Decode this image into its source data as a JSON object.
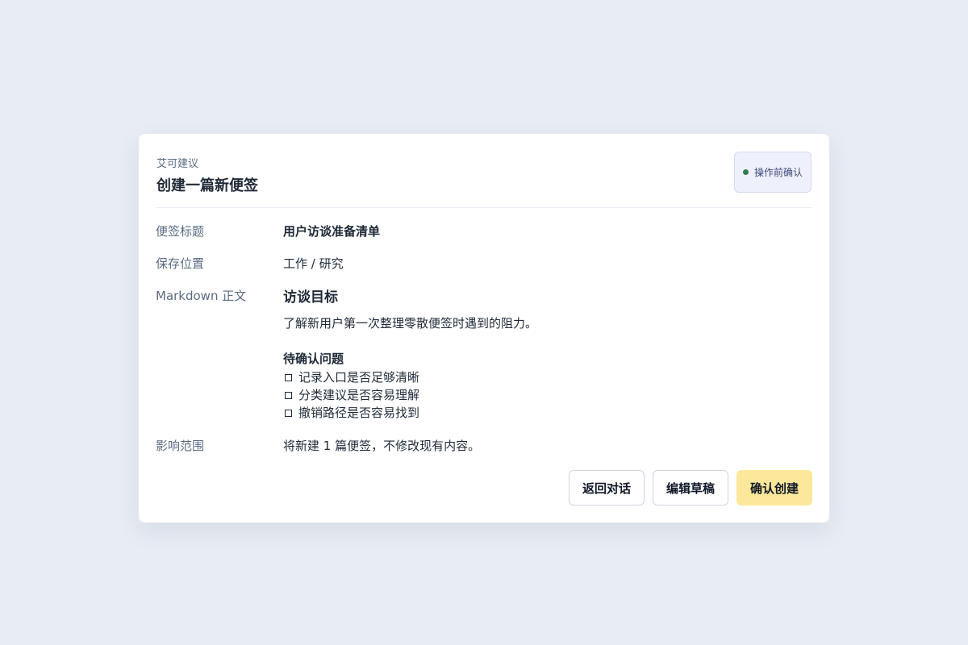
{
  "card": {
    "eyebrow": "艾可建议",
    "title": "创建一篇新便签",
    "badge": "操作前确认"
  },
  "fields": {
    "title_label": "便签标题",
    "title_value": "用户访谈准备清单",
    "location_label": "保存位置",
    "location_value": "工作 / 研究",
    "body_label": "Markdown 正文",
    "scope_label": "影响范围",
    "scope_value": "将新建 1 篇便签，不修改现有内容。"
  },
  "markdown": {
    "heading": "访谈目标",
    "paragraph": "了解新用户第一次整理零散便签时遇到的阻力。",
    "subheading": "待确认问题",
    "checklist": [
      "记录入口是否足够清晰",
      "分类建议是否容易理解",
      "撤销路径是否容易找到"
    ]
  },
  "actions": {
    "back": "返回对话",
    "edit": "编辑草稿",
    "confirm": "确认创建"
  },
  "colors": {
    "page_background": "#e8ecf4",
    "badge_dot": "#2f7d4f",
    "confirm_button": "#fce79a"
  },
  "icons": {
    "badge_dot": "status-dot-icon",
    "checklist_item": "checkbox-icon"
  }
}
